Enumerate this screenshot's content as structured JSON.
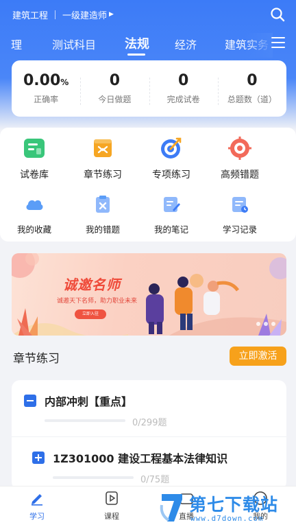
{
  "topbar": {
    "subject": "建筑工程",
    "level": "一级建造师",
    "level_arrow": "▶"
  },
  "tabs": [
    {
      "label": "理"
    },
    {
      "label": "测试科目"
    },
    {
      "label": "法规"
    },
    {
      "label": "经济"
    },
    {
      "label": "建筑实务"
    }
  ],
  "stats": [
    {
      "value": "0.00",
      "unit": "%",
      "label": "正确率"
    },
    {
      "value": "0",
      "unit": "",
      "label": "今日做题"
    },
    {
      "value": "0",
      "unit": "",
      "label": "完成试卷"
    },
    {
      "value": "0",
      "unit": "",
      "label": "总题数（道）"
    }
  ],
  "functions_primary": [
    {
      "label": "试卷库",
      "icon": "exam-library-icon"
    },
    {
      "label": "章节练习",
      "icon": "chapter-practice-icon"
    },
    {
      "label": "专项练习",
      "icon": "target-icon"
    },
    {
      "label": "高频错题",
      "icon": "frequent-errors-icon"
    }
  ],
  "functions_secondary": [
    {
      "label": "我的收藏",
      "icon": "cloud-icon"
    },
    {
      "label": "我的错题",
      "icon": "wrong-questions-icon"
    },
    {
      "label": "我的笔记",
      "icon": "notes-icon"
    },
    {
      "label": "学习记录",
      "icon": "study-record-icon"
    }
  ],
  "banner": {
    "title": "诚邀名师",
    "subtitle": "诚邀天下名师，助力职业未来",
    "button": "立即入驻"
  },
  "section": {
    "title": "章节练习",
    "action": "立即激活"
  },
  "chapters": [
    {
      "title": "内部冲刺【重点】",
      "count": "0/299题",
      "progress": 0,
      "expanded": true
    },
    {
      "title": "1Z301000 建设工程基本法律知识",
      "count": "0/75题",
      "progress": 0,
      "expanded": false
    }
  ],
  "bottom_nav": [
    {
      "label": "学习",
      "icon": "pen-icon",
      "active": true
    },
    {
      "label": "课程",
      "icon": "play-icon",
      "active": false
    },
    {
      "label": "直播",
      "icon": "live-icon",
      "active": false
    },
    {
      "label": "我的",
      "icon": "profile-icon",
      "active": false
    }
  ],
  "watermark": {
    "text": "第七下载站",
    "url": "www.d7down.com"
  },
  "colors": {
    "primary": "#3c7bf7",
    "accent": "#f7a11b",
    "banner_red": "#ef4b3a"
  }
}
